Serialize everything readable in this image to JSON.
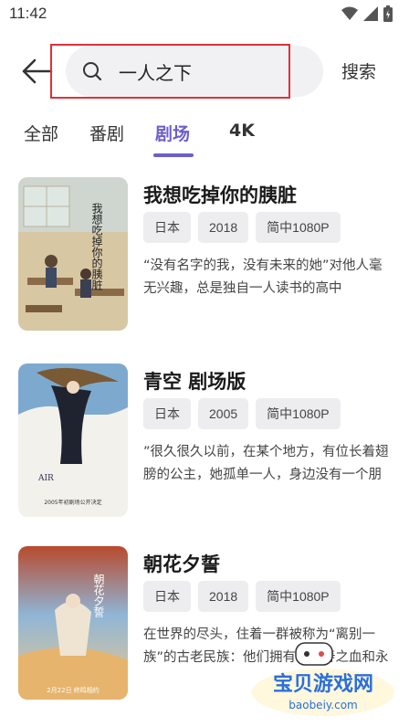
{
  "status": {
    "time": "11:42"
  },
  "search": {
    "query": "一人之下",
    "button_label": "搜索"
  },
  "tabs": [
    {
      "label": "全部",
      "active": false
    },
    {
      "label": "番剧",
      "active": false
    },
    {
      "label": "剧场",
      "active": true
    },
    {
      "label": "4K",
      "active": false
    }
  ],
  "results": [
    {
      "title": "我想吃掉你的胰脏",
      "tags": [
        "日本",
        "2018",
        "简中1080P"
      ],
      "description": "“没有名字的我，没有未来的她”对他人毫无兴趣，总是独自一人读书的高中生“我”。这样的“我”有一天，偶然捡…",
      "poster_text": "我想吃掉你的胰脏"
    },
    {
      "title": "青空 剧场版",
      "tags": [
        "日本",
        "2005",
        "简中1080P"
      ],
      "description": "”很久很久以前，在某个地方，有位长着翅膀的公主，她孤单一人，身边没有一个朋友。” 在一个能看见海和天空…",
      "poster_text": "AIR",
      "poster_caption": "2005年初剧场公开决定"
    },
    {
      "title": "朝花夕誓",
      "tags": [
        "日本",
        "2018",
        "简中1080P"
      ],
      "description": "在世界的尽头，住着一群被称为“离别一族”的古老民族：他们拥有着长寿之血和永生不老的面容。",
      "poster_text": "朝花夕誓",
      "poster_caption": "2月22日 终鸣相约"
    }
  ],
  "watermark": {
    "title": "宝贝游戏网",
    "url": "baobeiy.com"
  }
}
